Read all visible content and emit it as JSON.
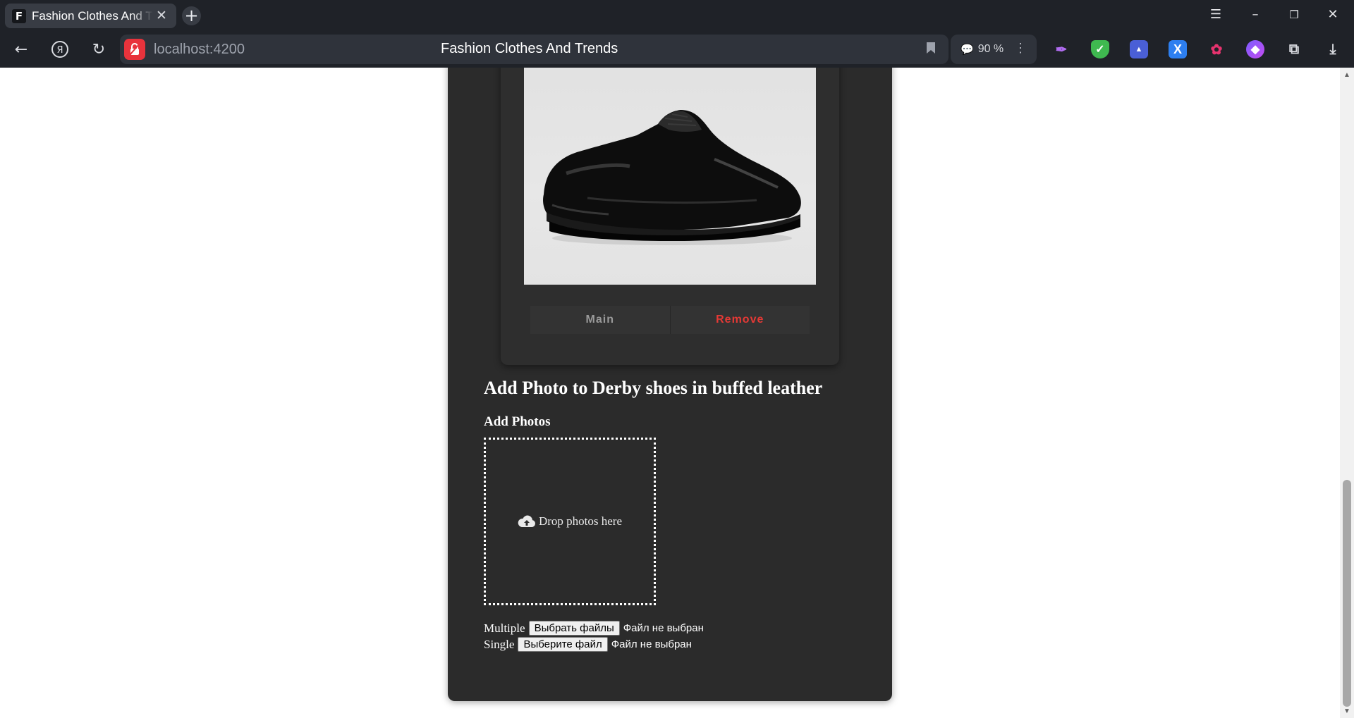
{
  "browser": {
    "tab_title": "Fashion Clothes And Trends",
    "tab_favicon_letter": "F",
    "url": "localhost:4200",
    "page_title": "Fashion Clothes And Trends",
    "zoom": "90 %"
  },
  "photo_card": {
    "image_alt": "Black patent leather derby shoe",
    "main_label": "Main",
    "remove_label": "Remove"
  },
  "upload": {
    "title": "Add Photo to Derby shoes in buffed leather",
    "subtitle": "Add Photos",
    "dropzone_text": "Drop photos here",
    "multiple_label": "Multiple",
    "multiple_button": "Выбрать файлы",
    "multiple_status": "Файл не выбран",
    "single_label": "Single",
    "single_button": "Выберите файл",
    "single_status": "Файл не выбран"
  },
  "colors": {
    "panel_bg": "#2b2b2b",
    "remove_accent": "#e53935",
    "chrome_bg": "#1f2228"
  }
}
